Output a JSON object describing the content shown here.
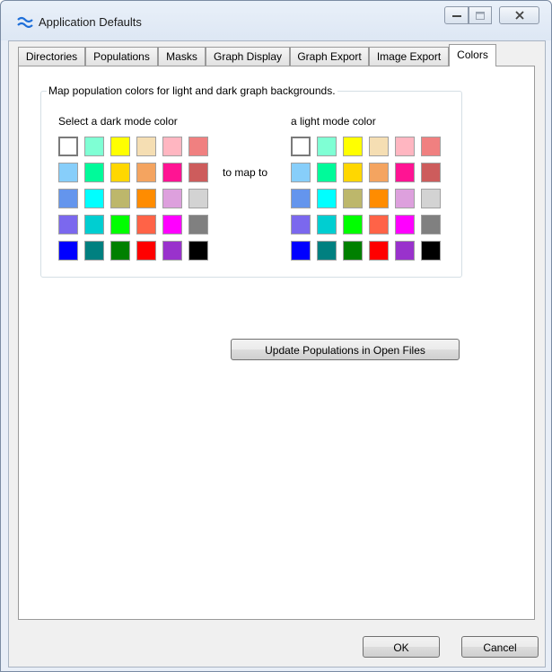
{
  "window": {
    "title": "Application Defaults",
    "icon": "waves-icon"
  },
  "tabs": [
    {
      "label": "Directories"
    },
    {
      "label": "Populations"
    },
    {
      "label": "Masks"
    },
    {
      "label": "Graph Display"
    },
    {
      "label": "Graph Export"
    },
    {
      "label": "Image Export"
    },
    {
      "label": "Colors",
      "active": true
    }
  ],
  "colors_tab": {
    "group_title": "Map population colors for light and dark graph backgrounds.",
    "dark_label": "Select a dark mode color",
    "map_label": "to map to",
    "light_label": "a light mode color",
    "update_button": "Update Populations in Open Files"
  },
  "palette": [
    [
      "#ffffff",
      "#7fffd4",
      "#ffff00",
      "#f5deb3",
      "#ffb6c1",
      "#f08080"
    ],
    [
      "#87cefa",
      "#00fa9a",
      "#ffd700",
      "#f4a460",
      "#ff1493",
      "#cd5c5c"
    ],
    [
      "#6495ed",
      "#00ffff",
      "#bdb76b",
      "#ff8c00",
      "#dda0dd",
      "#d3d3d3"
    ],
    [
      "#7b68ee",
      "#00ced1",
      "#00ff00",
      "#ff6347",
      "#ff00ff",
      "#808080"
    ],
    [
      "#0000ff",
      "#008080",
      "#008000",
      "#ff0000",
      "#9932cc",
      "#000000"
    ]
  ],
  "footer": {
    "ok": "OK",
    "cancel": "Cancel"
  }
}
